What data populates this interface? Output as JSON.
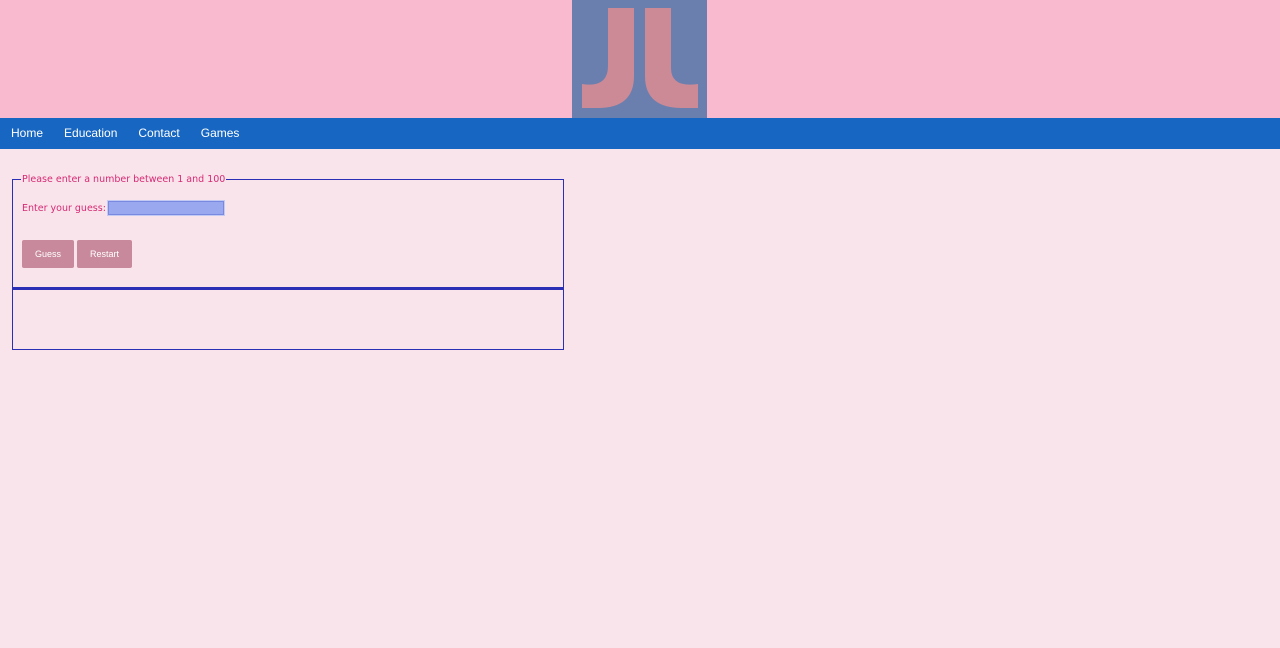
{
  "header": {
    "logo_icon": "jl-logo-icon",
    "colors": {
      "background": "#f9bad0",
      "logo_bg": "#6b7fae",
      "logo_fg": "#cc8a96"
    }
  },
  "nav": {
    "items": [
      {
        "label": "Home"
      },
      {
        "label": "Education"
      },
      {
        "label": "Contact"
      },
      {
        "label": "Games"
      }
    ],
    "color": "#1766c2"
  },
  "game": {
    "legend": "Please enter a number between 1 and 100",
    "guess_label": "Enter your guess:",
    "guess_value": "",
    "guess_button": "Guess",
    "restart_button": "Restart",
    "result_text": ""
  },
  "colors": {
    "page_bg": "#fae4ec",
    "accent_text": "#d62a73",
    "border": "#2a2fb5",
    "button": "#c8899c"
  }
}
